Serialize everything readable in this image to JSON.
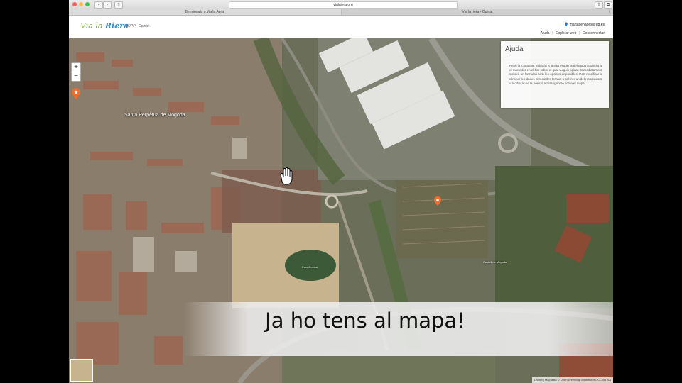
{
  "browser": {
    "url": "vialaiera.org",
    "tabs": [
      {
        "label": "Benvinguts a Via la Aera!"
      },
      {
        "label": "Via la riera - Opinat"
      }
    ],
    "new_tab_icon": "plus-icon"
  },
  "app": {
    "logo_text_1": "Via la",
    "logo_text_2": "Riera",
    "subtitle": "DIOPP - Opinat",
    "user_email": "martabenages@ub.es",
    "links": [
      "Ajuda",
      "Explorar web",
      "Desconnectar"
    ]
  },
  "map": {
    "zoom_in": "+",
    "zoom_out": "−",
    "labels": {
      "town": "Santa Perpètua de Mogoda",
      "park": "Parc Central",
      "castle": "Castell de Mogoda"
    },
    "attribution": "Leaflet | Map data © OpenStreetMap contributors, CC-BY-SA"
  },
  "help_panel": {
    "title": "Ajuda",
    "body": "Prem la icona que trobaràs a la part esquerra del mapa i posiciona el marcador en el lloc sobre el qual vulguis opinar. Immediatament s'obrirà un formulari amb les opcions disponibles. Pots modificar o eliminar les dades introduïdes tornant a prémer un dels marcadors o modificar-ne la posició arrossegant-lo sobre el mapa."
  },
  "caption": "Ja ho tens al mapa!",
  "colors": {
    "accent_green": "#7aa63a",
    "accent_blue": "#2f8fd6",
    "marker_orange": "#ee6c2c"
  }
}
